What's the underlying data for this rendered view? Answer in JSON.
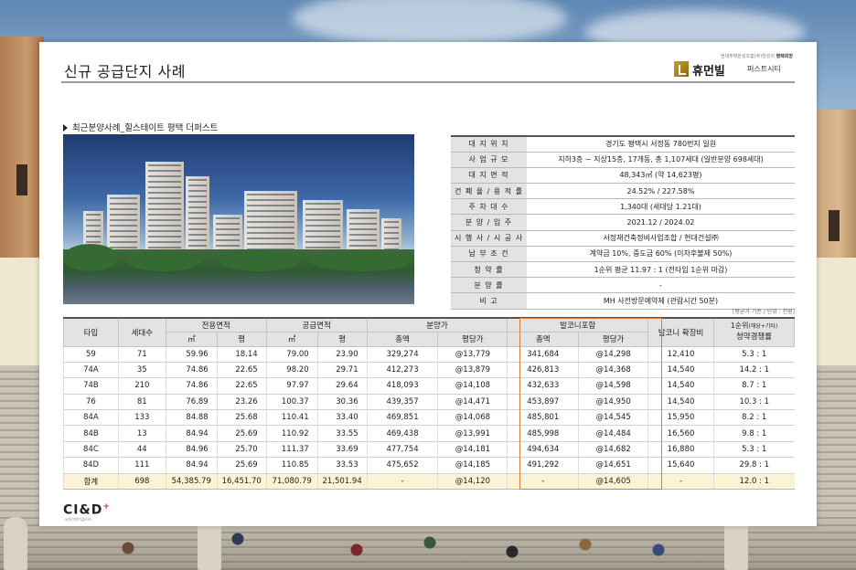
{
  "slide": {
    "title": "신규 공급단지 사례",
    "brand_tagline_prefix": "현대주택한성조합(주)한성의",
    "brand_tagline_bold": "평택희망",
    "brand_name": "휴먼빌",
    "brand_sub": "퍼스트시티",
    "section_heading": "최근분양사례_힐스테이트 평택 더퍼스트",
    "footer_logo": "CI&D",
    "footer_logo_plus": "+",
    "footer_sub": "씨아이앤디플러스"
  },
  "info": [
    {
      "key": "대 지 위 치",
      "value": "경기도 평택시 서정동 780번지 일원"
    },
    {
      "key": "사 업 규 모",
      "value": "지하3층 ~ 지상15층, 17개동, 총 1,107세대 (일반분양 698세대)"
    },
    {
      "key": "대 지 면 적",
      "value": "48,343㎡ (약 14,623평)"
    },
    {
      "key": "건 폐 율 / 용 적 률",
      "value": "24.52% / 227.58%"
    },
    {
      "key": "주 차 대 수",
      "value": "1,340대 (세대당 1.21대)"
    },
    {
      "key": "분 양 / 입 주",
      "value": "2021.12 / 2024.02"
    },
    {
      "key": "시 행 사 / 시 공 사",
      "value": "서정재건축정비사업조합 / 현대건설㈜"
    },
    {
      "key": "납 부 조 건",
      "value": "계약금 10%, 중도금 60% (이자후불제 50%)"
    },
    {
      "key": "청 약 률",
      "value": "1순위 평균 11.97 : 1 (전타입 1순위 마감)"
    },
    {
      "key": "분 양 률",
      "value": "-"
    },
    {
      "key": "비 고",
      "value": "MH 사전방문예약제 (관람시간 50분)"
    }
  ],
  "units_note": "[평균가 기준 / 단위 : 천원]",
  "table": {
    "headers": {
      "type": "타입",
      "households": "세대수",
      "exclusive": "전용면적",
      "supply": "공급면적",
      "price": "분양가",
      "balcony_incl": "발코니포함",
      "balcony_ext": "발코니 확장비",
      "competition_line1": "1순위",
      "competition_small": "(해당+기타)",
      "competition_line2": "청약경쟁률",
      "sqm": "㎡",
      "pyeong": "평",
      "total": "총액",
      "per_pyeong": "평당가"
    },
    "rows": [
      [
        "59",
        "71",
        "59.96",
        "18.14",
        "79.00",
        "23.90",
        "329,274",
        "@13,779",
        "341,684",
        "@14,298",
        "12,410",
        "5.3 : 1"
      ],
      [
        "74A",
        "35",
        "74.86",
        "22.65",
        "98.20",
        "29.71",
        "412,273",
        "@13,879",
        "426,813",
        "@14,368",
        "14,540",
        "14.2 : 1"
      ],
      [
        "74B",
        "210",
        "74.86",
        "22.65",
        "97.97",
        "29.64",
        "418,093",
        "@14,108",
        "432,633",
        "@14,598",
        "14,540",
        "8.7 : 1"
      ],
      [
        "76",
        "81",
        "76.89",
        "23.26",
        "100.37",
        "30.36",
        "439,357",
        "@14,471",
        "453,897",
        "@14,950",
        "14,540",
        "10.3 : 1"
      ],
      [
        "84A",
        "133",
        "84.88",
        "25.68",
        "110.41",
        "33.40",
        "469,851",
        "@14,068",
        "485,801",
        "@14,545",
        "15,950",
        "8.2 : 1"
      ],
      [
        "84B",
        "13",
        "84.94",
        "25.69",
        "110.92",
        "33.55",
        "469,438",
        "@13,991",
        "485,998",
        "@14,484",
        "16,560",
        "9.8 : 1"
      ],
      [
        "84C",
        "44",
        "84.96",
        "25.70",
        "111.37",
        "33.69",
        "477,754",
        "@14,181",
        "494,634",
        "@14,682",
        "16,880",
        "5.3 : 1"
      ],
      [
        "84D",
        "111",
        "84.94",
        "25.69",
        "110.85",
        "33.53",
        "475,652",
        "@14,185",
        "491,292",
        "@14,651",
        "15,640",
        "29.8 : 1"
      ]
    ],
    "total": [
      "합계",
      "698",
      "54,385.79",
      "16,451.70",
      "71,080.79",
      "21,501.94",
      "-",
      "@14,120",
      "-",
      "@14,605",
      "-",
      "12.0 : 1"
    ]
  },
  "colors": {
    "highlight_border": "#e07a3c",
    "header_bg": "#e3e3e3",
    "total_row_bg": "#fcf3d4"
  }
}
